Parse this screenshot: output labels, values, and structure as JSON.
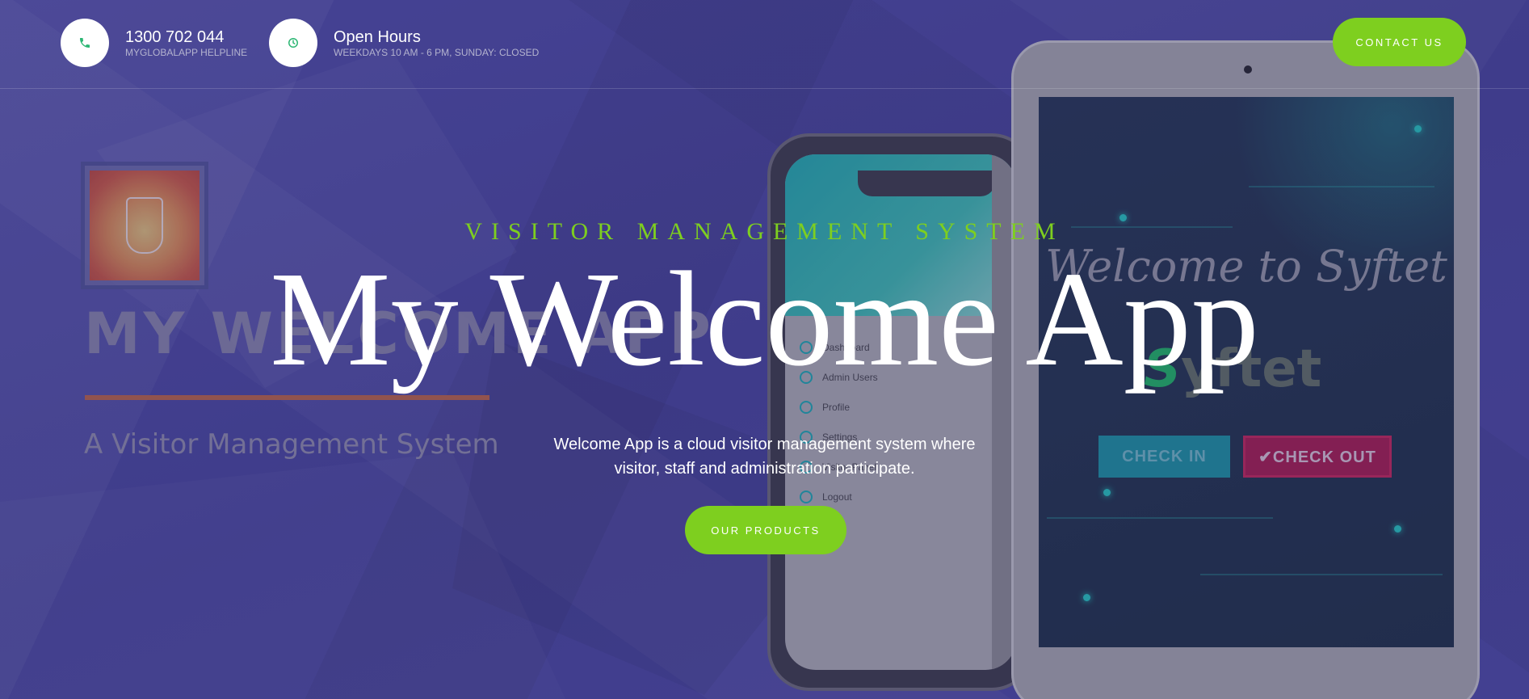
{
  "topbar": {
    "phone": {
      "icon": "phone-icon",
      "title": "1300 702 044",
      "subtitle": "MYGLOBALAPP HELPLINE"
    },
    "hours": {
      "icon": "clock-icon",
      "title": "Open Hours",
      "subtitle": "WEEKDAYS 10 AM - 6 PM, SUNDAY: CLOSED"
    },
    "contact_label": "CONTACT US"
  },
  "hero": {
    "eyebrow": "VISITOR MANAGEMENT SYSTEM",
    "title": "My Welcome App",
    "description": "Welcome App is a cloud visitor management system where visitor, staff and administration participate.",
    "cta_label": "OUR PRODUCTS"
  },
  "background": {
    "logo_title": "MY WELCOME APP",
    "logo_subtitle": "A Visitor Management System",
    "phone_menu": [
      "Dashboard",
      "Admin Users",
      "Profile",
      "Settings",
      "Visitor Panel",
      "Logout"
    ],
    "tablet_welcome": "Welcome to Syftet",
    "tablet_brand_s": "S",
    "tablet_brand_rest": "yftet",
    "check_in_label": "CHECK IN",
    "check_out_label": "✔CHECK OUT"
  },
  "colors": {
    "accent": "#7ecf1f",
    "background": "#45428a",
    "icon_green": "#2bb673"
  }
}
